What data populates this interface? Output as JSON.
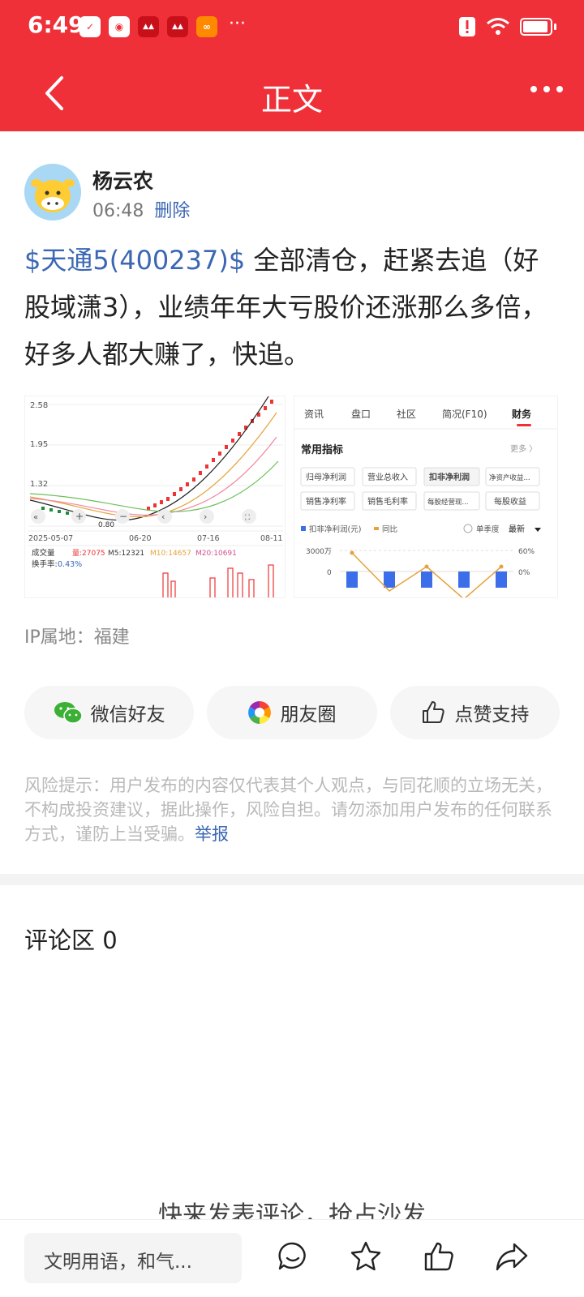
{
  "status_bar": {
    "time": "6:49"
  },
  "nav": {
    "title": "正文"
  },
  "author": {
    "name": "杨云农",
    "time": "06:48",
    "delete_label": "删除"
  },
  "post": {
    "stock_tag": "$天通5(400237)$",
    "text": " 全部清仓，赶紧去追（好股域潇3），业绩年年大亏股价还涨那么多倍，好多人都大赚了，快追。"
  },
  "chart_left": {
    "y_ticks": [
      "2.58",
      "1.95",
      "1.32"
    ],
    "low_label": "0.80",
    "x_ticks": [
      "2025-05-07",
      "06-20",
      "07-16",
      "08-11"
    ],
    "volume_label": "成交量",
    "vol_values": {
      "vol": "量:27075",
      "m5": "M5:12321",
      "m10": "M10:14657",
      "m20": "M20:10691"
    },
    "turnover": "换手率:",
    "turnover_value": "0.43%"
  },
  "chart_right": {
    "tabs": [
      "资讯",
      "盘口",
      "社区",
      "简况(F10)",
      "财务"
    ],
    "section_title": "常用指标",
    "more_label": "更多 〉",
    "metrics": [
      "归母净利润",
      "营业总收入",
      "扣非净利润",
      "净资产收益...",
      "销售净利率",
      "销售毛利率",
      "每股经营现...",
      "每股收益"
    ],
    "legend_bar": "扣非净利润(元)",
    "legend_line": "同比",
    "single_quarter": "单季度",
    "latest": "最新",
    "y_left": [
      "3000万",
      "0"
    ],
    "y_right": [
      "60%",
      "0%"
    ]
  },
  "ip_location": "IP属地：福建",
  "share": {
    "wechat": "微信好友",
    "moments": "朋友圈",
    "like": "点赞支持"
  },
  "risk": {
    "text": "风险提示：用户发布的内容仅代表其个人观点，与同花顺的立场无关，不构成投资建议，据此操作，风险自担。请勿添加用户发布的任何联系方式，谨防上当受骗。",
    "report_label": "举报"
  },
  "comments": {
    "title": "评论区 0",
    "empty_hint": "快来发表评论，抢占沙发"
  },
  "bottom": {
    "input_placeholder": "文明用语，和气..."
  }
}
